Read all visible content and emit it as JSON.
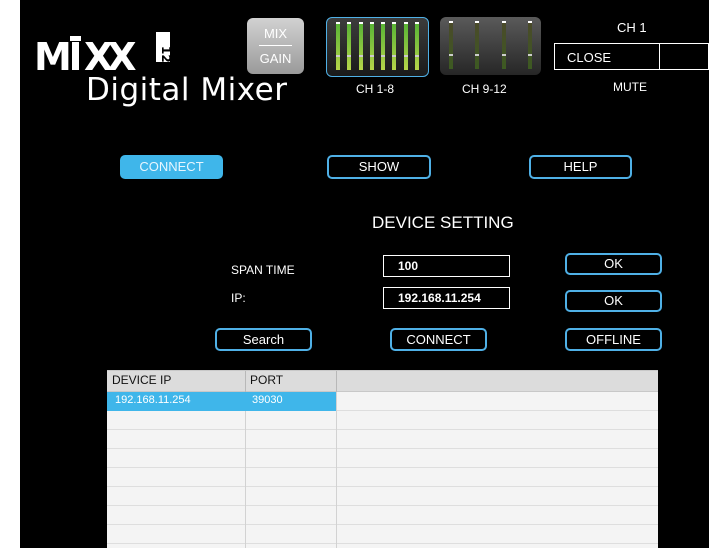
{
  "header": {
    "logo_text": "MiXX 12",
    "app_title": "Digital Mixer",
    "mix_label": "MIX",
    "gain_label": "GAIN",
    "meter_groups": [
      {
        "label": "CH 1-8",
        "selected": true
      },
      {
        "label": "CH 9-12",
        "selected": false
      }
    ],
    "channel": "CH 1",
    "close_label": "CLOSE",
    "mute_label": "MUTE"
  },
  "nav": {
    "connect": "CONNECT",
    "show": "SHOW",
    "help": "HELP"
  },
  "device": {
    "title": "DEVICE SETTING",
    "span_time_label": "SPAN TIME",
    "span_time_value": "100",
    "ip_label": "IP:",
    "ip_value": "192.168.11.254",
    "ok_label": "OK",
    "search_label": "Search",
    "connect_label": "CONNECT",
    "offline_label": "OFFLINE"
  },
  "table": {
    "columns": [
      "DEVICE IP",
      "PORT"
    ],
    "rows": [
      {
        "ip": "192.168.11.254",
        "port": "39030",
        "selected": true
      }
    ],
    "selected_color": "#3fb6ea"
  },
  "colors": {
    "accent": "#4fb0e6",
    "background": "#000000"
  }
}
